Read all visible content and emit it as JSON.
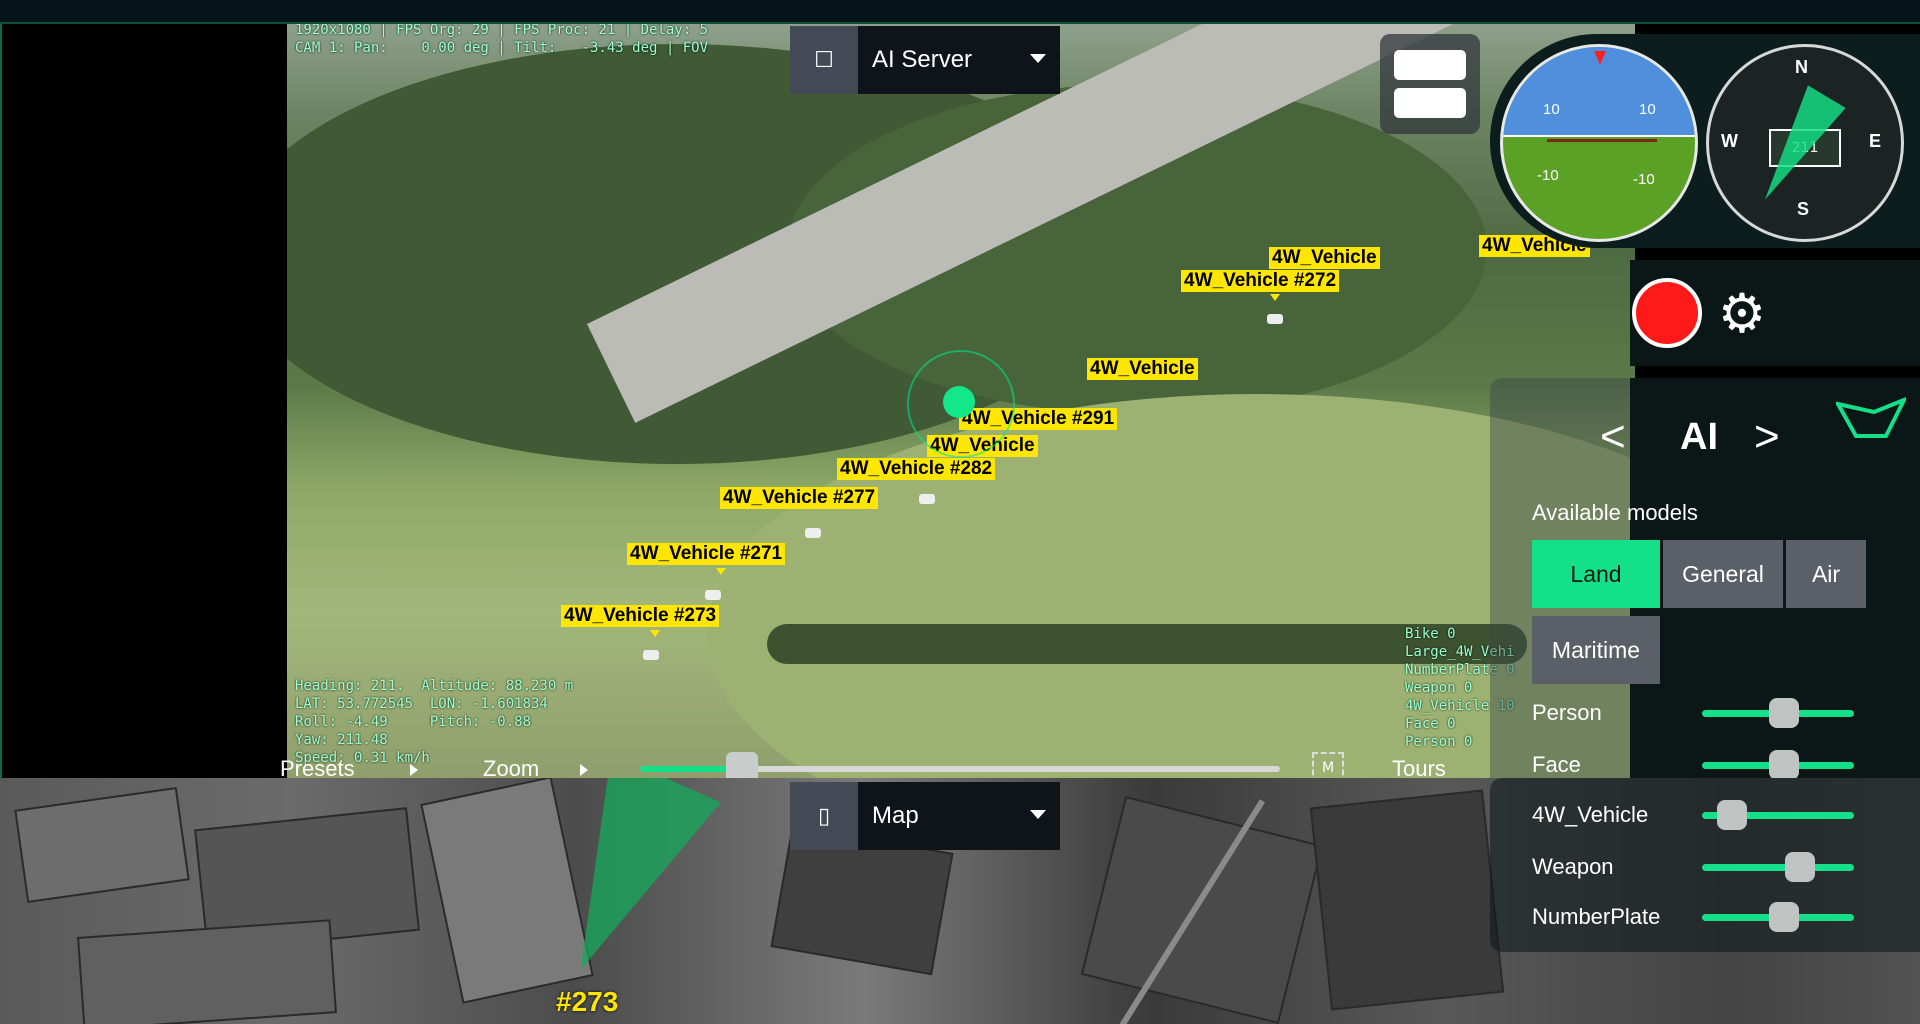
{
  "video": {
    "stats_line1": "1920x1080 | FPS Org: 29 | FPS Proc: 21 | Delay: 5",
    "stats_line2": "CAM 1: Pan:    0.00 deg | Tilt:   -3.43 deg | FOV",
    "telemetry": [
      "Heading: 211.  Altitude: 88.230 m",
      "LAT: 53.772545  LON: -1.601834",
      "Roll: -4.49     Pitch: -0.88",
      "Yaw: 211.48",
      "Speed: 0.31 km/h"
    ],
    "counts": [
      "Bike 0",
      "Large_4W_Vehi",
      "NumberPlate 0",
      "Weapon 0",
      "4W_Vehicle 10",
      "Face 0",
      "Person 0"
    ],
    "detections": [
      {
        "label": "4W_Vehicle"
      },
      {
        "label": "4W_Vehicle #272"
      },
      {
        "label": "4W_Vehicle"
      },
      {
        "label": "4W_Vehicle"
      },
      {
        "label": "4W_Vehicle #291"
      },
      {
        "label": "4W_Vehicle"
      },
      {
        "label": "4W_Vehicle #282"
      },
      {
        "label": "4W_Vehicle #277"
      },
      {
        "label": "4W_Vehicle #271"
      },
      {
        "label": "4W_Vehicle #273"
      }
    ]
  },
  "ai_server_select": {
    "label": "AI Server"
  },
  "map_select": {
    "label": "Map"
  },
  "attitude": {
    "top_left": "10",
    "top_right": "10",
    "bottom_left": "-10",
    "bottom_right": "-10"
  },
  "compass": {
    "n": "N",
    "s": "S",
    "e": "E",
    "w": "W",
    "heading": "211"
  },
  "ai_panel": {
    "title": "AI",
    "prev": "<",
    "next": ">",
    "models_label": "Available models",
    "models": [
      {
        "label": "Land",
        "active": true
      },
      {
        "label": "General",
        "active": false
      },
      {
        "label": "Air",
        "active": false
      },
      {
        "label": "Maritime",
        "active": false
      }
    ],
    "sliders": [
      {
        "label": "Person",
        "value": 0.55
      },
      {
        "label": "Face",
        "value": 0.55
      },
      {
        "label": "4W_Vehicle",
        "value": 0.12
      },
      {
        "label": "Weapon",
        "value": 0.68
      },
      {
        "label": "NumberPlate",
        "value": 0.55
      }
    ]
  },
  "controls": {
    "presets": "Presets",
    "zoom": "Zoom",
    "tours": "Tours",
    "m_label": "M",
    "zoom_level": 0.16
  },
  "map": {
    "target_label": "#273"
  },
  "colors": {
    "accent": "#14e08a",
    "detection": "#ffe600",
    "record": "#ff1a1a"
  }
}
